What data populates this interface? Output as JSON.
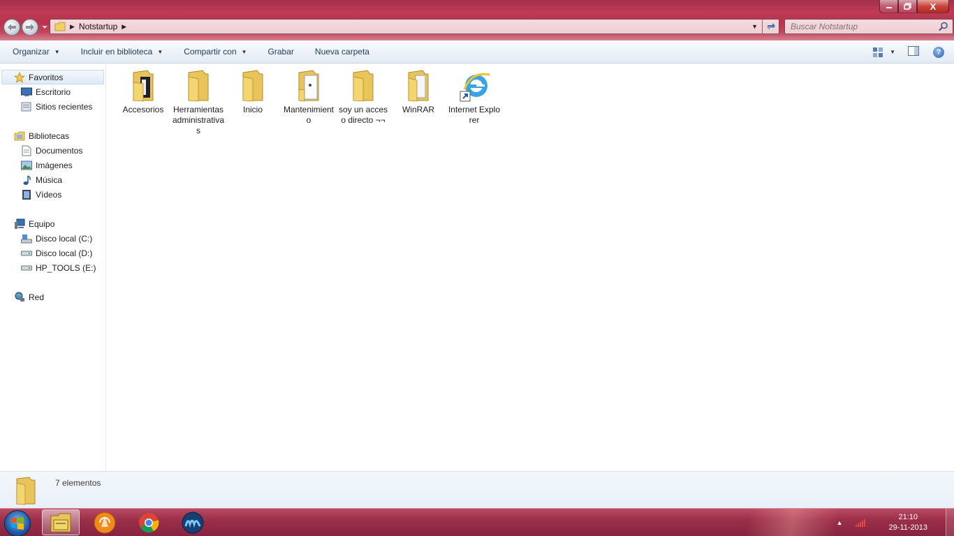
{
  "window": {
    "minimize_icon": "minimize-icon",
    "maximize_icon": "restore-icon",
    "close_icon": "close-icon",
    "close_label": "X"
  },
  "address": {
    "crumbs": [
      "Notstartup"
    ],
    "search_placeholder": "Buscar Notstartup"
  },
  "toolbar": {
    "organize": "Organizar",
    "include": "Incluir en biblioteca",
    "share": "Compartir con",
    "burn": "Grabar",
    "new_folder": "Nueva carpeta",
    "help": "?"
  },
  "sidebar": {
    "favorites": {
      "label": "Favoritos",
      "items": [
        {
          "label": "Escritorio"
        },
        {
          "label": "Sitios recientes"
        }
      ]
    },
    "libraries": {
      "label": "Bibliotecas",
      "items": [
        {
          "label": "Documentos"
        },
        {
          "label": "Imágenes"
        },
        {
          "label": "Música"
        },
        {
          "label": "Vídeos"
        }
      ]
    },
    "computer": {
      "label": "Equipo",
      "items": [
        {
          "label": "Disco local (C:)"
        },
        {
          "label": "Disco local (D:)"
        },
        {
          "label": "HP_TOOLS (E:)"
        }
      ]
    },
    "network": {
      "label": "Red"
    }
  },
  "files": [
    {
      "label": "Accesorios",
      "icon": "folder-icon"
    },
    {
      "label": "Herramientas administrativas",
      "icon": "folder-icon"
    },
    {
      "label": "Inicio",
      "icon": "folder-icon"
    },
    {
      "label": "Mantenimiento",
      "icon": "folder-icon"
    },
    {
      "label": "soy un acceso directo ¬¬",
      "icon": "folder-icon"
    },
    {
      "label": "WinRAR",
      "icon": "folder-icon"
    },
    {
      "label": "Internet Explorer",
      "icon": "internet-explorer-icon"
    }
  ],
  "status": {
    "count": "7 elementos"
  },
  "taskbar": {
    "time": "21:10",
    "date": "29-11-2013",
    "apps": [
      "windows-explorer-icon",
      "vlc-media-player-icon",
      "chrome-icon",
      "app-m-icon"
    ]
  },
  "colors": {
    "accent": "#b8334c",
    "taskbar": "#9c2f49",
    "command_text": "#1e395b"
  }
}
